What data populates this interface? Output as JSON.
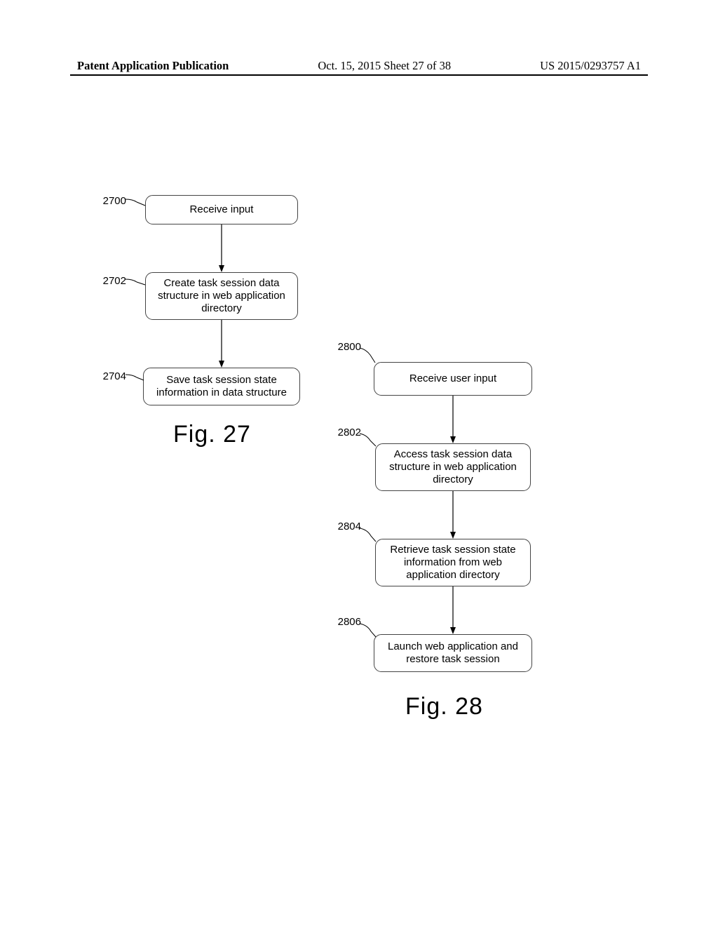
{
  "header": {
    "ptype": "Patent Application Publication",
    "pdate": "Oct. 15, 2015  Sheet 27 of 38",
    "pnum": "US 2015/0293757 A1"
  },
  "fig27": {
    "label": "Fig. 27",
    "refs": {
      "b0": "2700",
      "b1": "2702",
      "b2": "2704"
    },
    "boxes": {
      "b0": "Receive input",
      "b1": "Create task session data\nstructure in web application\ndirectory",
      "b2": "Save task session state\ninformation in data structure"
    }
  },
  "fig28": {
    "label": "Fig. 28",
    "refs": {
      "b0": "2800",
      "b1": "2802",
      "b2": "2804",
      "b3": "2806"
    },
    "boxes": {
      "b0": "Receive user input",
      "b1": "Access task session data\nstructure in web application\ndirectory",
      "b2": "Retrieve task session state\ninformation from web\napplication directory",
      "b3": "Launch web application and\nrestore task session"
    }
  },
  "chart_data": [
    {
      "type": "flowchart",
      "title": "Fig. 27",
      "nodes": [
        {
          "id": "2700",
          "label": "Receive input"
        },
        {
          "id": "2702",
          "label": "Create task session data structure in web application directory"
        },
        {
          "id": "2704",
          "label": "Save task session state information in data structure"
        }
      ],
      "edges": [
        {
          "from": "2700",
          "to": "2702"
        },
        {
          "from": "2702",
          "to": "2704"
        }
      ]
    },
    {
      "type": "flowchart",
      "title": "Fig. 28",
      "nodes": [
        {
          "id": "2800",
          "label": "Receive user input"
        },
        {
          "id": "2802",
          "label": "Access task session data structure in web application directory"
        },
        {
          "id": "2804",
          "label": "Retrieve task session state information from web application directory"
        },
        {
          "id": "2806",
          "label": "Launch web application and restore task session"
        }
      ],
      "edges": [
        {
          "from": "2800",
          "to": "2802"
        },
        {
          "from": "2802",
          "to": "2804"
        },
        {
          "from": "2804",
          "to": "2806"
        }
      ]
    }
  ]
}
